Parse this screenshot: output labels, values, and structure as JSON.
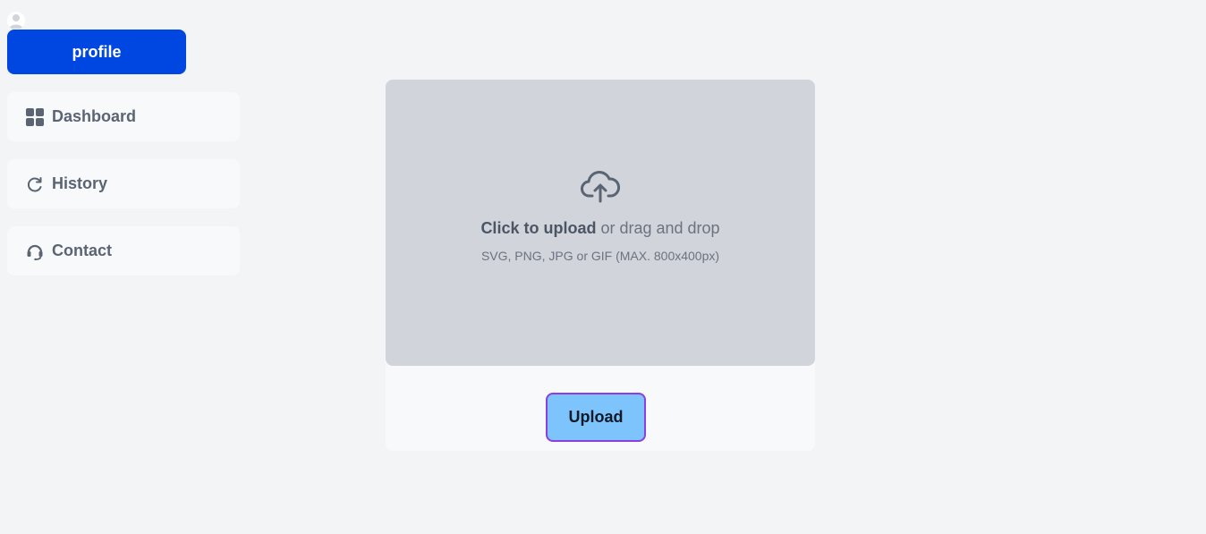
{
  "sidebar": {
    "profile_label": "profile",
    "items": [
      {
        "label": "Dashboard",
        "icon": "grid-icon"
      },
      {
        "label": "History",
        "icon": "refresh-icon"
      },
      {
        "label": "Contact",
        "icon": "headset-icon"
      }
    ]
  },
  "upload": {
    "click_text": "Click to upload",
    "drag_text": " or drag and drop",
    "hint": "SVG, PNG, JPG or GIF (MAX. 800x400px)",
    "button_label": "Upload"
  },
  "colors": {
    "page_bg": "#f3f4f6",
    "primary": "#0046e0",
    "dropzone_bg": "#d1d5db",
    "upload_button_bg": "#7cc4fb",
    "upload_button_border": "#8b3fe0"
  }
}
